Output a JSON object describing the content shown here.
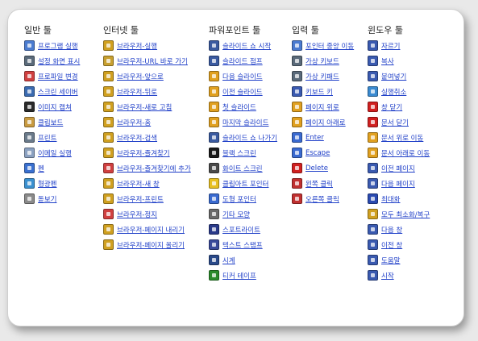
{
  "columns": [
    {
      "id": "general",
      "title": "일반 툴",
      "items": [
        {
          "label": "프로그램 실행",
          "icon": "run-program-icon",
          "color": "#4a7bd0"
        },
        {
          "label": "설정 화면 표시",
          "icon": "settings-screen-icon",
          "color": "#5a6a7a"
        },
        {
          "label": "프로파일 변경",
          "icon": "profile-change-icon",
          "color": "#d04040"
        },
        {
          "label": "스크린 세이버",
          "icon": "screensaver-icon",
          "color": "#3a6ab0"
        },
        {
          "label": "이미지 캡쳐",
          "icon": "image-capture-icon",
          "color": "#2a2a2a"
        },
        {
          "label": "클립보드",
          "icon": "clipboard-icon",
          "color": "#c89a40"
        },
        {
          "label": "프린트",
          "icon": "printer-icon",
          "color": "#6a7a8a"
        },
        {
          "label": "이메일 실행",
          "icon": "email-icon",
          "color": "#8aa0c0"
        },
        {
          "label": "펜",
          "icon": "pen-icon",
          "color": "#3a70d0"
        },
        {
          "label": "형광펜",
          "icon": "highlighter-icon",
          "color": "#3a90d0"
        },
        {
          "label": "돋보기",
          "icon": "magnifier-icon",
          "color": "#8a8a8a"
        }
      ]
    },
    {
      "id": "internet",
      "title": "인터넷 툴",
      "items": [
        {
          "label": "브라우저-실행",
          "icon": "browser-launch-icon",
          "color": "#d0a020"
        },
        {
          "label": "브라우저-URL 바로 가기",
          "icon": "browser-url-icon",
          "color": "#c8a030"
        },
        {
          "label": "브라우저-앞으로",
          "icon": "browser-forward-icon",
          "color": "#d0a020"
        },
        {
          "label": "브라우저-뒤로",
          "icon": "browser-back-icon",
          "color": "#d0a020"
        },
        {
          "label": "브라우저-새로 고침",
          "icon": "browser-refresh-icon",
          "color": "#d0a020"
        },
        {
          "label": "브라우저-홈",
          "icon": "browser-home-icon",
          "color": "#d0a020"
        },
        {
          "label": "브라우저-검색",
          "icon": "browser-search-icon",
          "color": "#d0a020"
        },
        {
          "label": "브라우저-즐겨찾기",
          "icon": "browser-favorites-icon",
          "color": "#d0a020"
        },
        {
          "label": "브라우저-즐겨찾기에 추가",
          "icon": "browser-add-favorite-icon",
          "color": "#d04040"
        },
        {
          "label": "브라우저-새 창",
          "icon": "browser-new-window-icon",
          "color": "#d0a020"
        },
        {
          "label": "브라우저-프린트",
          "icon": "browser-print-icon",
          "color": "#d0a020"
        },
        {
          "label": "브라우저-정지",
          "icon": "browser-stop-icon",
          "color": "#d04040"
        },
        {
          "label": "브라우저-페이지 내리기",
          "icon": "browser-page-down-icon",
          "color": "#d0a020"
        },
        {
          "label": "브라우저-페이지 올리기",
          "icon": "browser-page-up-icon",
          "color": "#d0a020"
        }
      ]
    },
    {
      "id": "powerpoint",
      "title": "파워포인트 툴",
      "items": [
        {
          "label": "슬라이드 쇼 시작",
          "icon": "slideshow-start-icon",
          "color": "#3a5aa0"
        },
        {
          "label": "슬라이드 점프",
          "icon": "slide-jump-icon",
          "color": "#3a5aa0"
        },
        {
          "label": "다음 슬라이드",
          "icon": "next-slide-icon",
          "color": "#e0a020"
        },
        {
          "label": "이전 슬라이드",
          "icon": "previous-slide-icon",
          "color": "#e0a020"
        },
        {
          "label": "첫 슬라이드",
          "icon": "first-slide-icon",
          "color": "#e0a020"
        },
        {
          "label": "마지막 슬라이드",
          "icon": "last-slide-icon",
          "color": "#e0a020"
        },
        {
          "label": "슬라이드 쇼 나가기",
          "icon": "slideshow-exit-icon",
          "color": "#3a5aa0"
        },
        {
          "label": "블랙 스크린",
          "icon": "black-screen-icon",
          "color": "#1a1a1a"
        },
        {
          "label": "화이트 스크린",
          "icon": "white-screen-icon",
          "color": "#4a4a4a"
        },
        {
          "label": "클립아트 포인터",
          "icon": "clipart-pointer-icon",
          "color": "#e8c020"
        },
        {
          "label": "도형 포인터",
          "icon": "shape-pointer-icon",
          "color": "#3a6ad0"
        },
        {
          "label": "기타 모양",
          "icon": "other-shape-icon",
          "color": "#6a6a6a"
        },
        {
          "label": "스포트라이트",
          "icon": "spotlight-icon",
          "color": "#2a3a8a"
        },
        {
          "label": "텍스트 스탬프",
          "icon": "text-stamp-icon",
          "color": "#3a4a9a"
        },
        {
          "label": "시계",
          "icon": "clock-icon",
          "color": "#2a4a8a"
        },
        {
          "label": "티커 테이프",
          "icon": "ticker-tape-icon",
          "color": "#2a8a2a"
        }
      ]
    },
    {
      "id": "input",
      "title": "입력 툴",
      "items": [
        {
          "label": "포인터 중앙 이동",
          "icon": "pointer-center-icon",
          "color": "#4a7ad0"
        },
        {
          "label": "가상 키보드",
          "icon": "virtual-keyboard-icon",
          "color": "#5a6a7a"
        },
        {
          "label": "가상 키패드",
          "icon": "virtual-keypad-icon",
          "color": "#5a6a7a"
        },
        {
          "label": "키보드 키",
          "icon": "keyboard-key-icon",
          "color": "#3a5ab0"
        },
        {
          "label": "페이지 위로",
          "icon": "page-up-icon",
          "color": "#e0a020"
        },
        {
          "label": "페이지 아래로",
          "icon": "page-down-icon",
          "color": "#e0a020"
        },
        {
          "label": "Enter",
          "icon": "enter-icon",
          "color": "#3a6ad0"
        },
        {
          "label": "Escape",
          "icon": "escape-icon",
          "color": "#3a6ad0"
        },
        {
          "label": "Delete",
          "icon": "delete-icon",
          "color": "#d02020"
        },
        {
          "label": "왼쪽 클릭",
          "icon": "left-click-icon",
          "color": "#c03030"
        },
        {
          "label": "오른쪽 클릭",
          "icon": "right-click-icon",
          "color": "#c03030"
        }
      ]
    },
    {
      "id": "window",
      "title": "윈도우 툴",
      "items": [
        {
          "label": "자르기",
          "icon": "cut-icon",
          "color": "#3a5ab0"
        },
        {
          "label": "복사",
          "icon": "copy-icon",
          "color": "#3a5ab0"
        },
        {
          "label": "붙여넣기",
          "icon": "paste-icon",
          "color": "#3a5ab0"
        },
        {
          "label": "실행취소",
          "icon": "undo-icon",
          "color": "#3a8ad0"
        },
        {
          "label": "창 닫기",
          "icon": "close-window-icon",
          "color": "#d02020"
        },
        {
          "label": "문서 닫기",
          "icon": "close-document-icon",
          "color": "#d02020"
        },
        {
          "label": "문서 위로 이동",
          "icon": "document-up-icon",
          "color": "#e0a020"
        },
        {
          "label": "문서 아래로 이동",
          "icon": "document-down-icon",
          "color": "#e0a020"
        },
        {
          "label": "이전 페이지",
          "icon": "previous-page-icon",
          "color": "#3a5ab0"
        },
        {
          "label": "다음 페이지",
          "icon": "next-page-icon",
          "color": "#3a5ab0"
        },
        {
          "label": "최대화",
          "icon": "maximize-icon",
          "color": "#2a4ab0"
        },
        {
          "label": "모두 최소화/복구",
          "icon": "minimize-all-icon",
          "color": "#d0a020"
        },
        {
          "label": "다음 창",
          "icon": "next-window-icon",
          "color": "#3a5ab0"
        },
        {
          "label": "이전 창",
          "icon": "previous-window-icon",
          "color": "#3a5ab0"
        },
        {
          "label": "도움말",
          "icon": "help-icon",
          "color": "#3a5ab0"
        },
        {
          "label": "시작",
          "icon": "start-icon",
          "color": "#3a5ab0"
        }
      ]
    }
  ]
}
